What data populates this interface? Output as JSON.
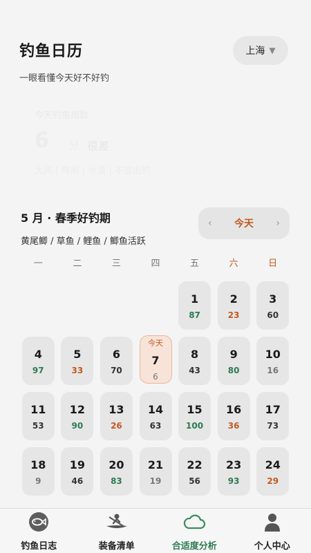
{
  "header": {
    "title": "钓鱼日历",
    "subtitle": "一眼看懂今天好不好钓"
  },
  "city": {
    "label": "上海",
    "caret": "▼"
  },
  "today_card": {
    "label": "今天钓鱼指数",
    "score": "6",
    "unit": "分",
    "level": "很差",
    "detail": "大风 | 降雨 | 水温 | 不宜出钓"
  },
  "month": {
    "title": "5 月 · 春季好钓期",
    "species": "黄尾鲫 / 草鱼 / 鲤鱼 / 鲫鱼活跃"
  },
  "nav": {
    "prev": "‹",
    "today": "今天",
    "next": "›"
  },
  "weekdays": [
    "一",
    "二",
    "三",
    "四",
    "五",
    "六",
    "日"
  ],
  "weekend_indices": [
    5,
    6
  ],
  "today_tag": "今天",
  "days": [
    {
      "day": "1",
      "score": "87",
      "tone": "green"
    },
    {
      "day": "2",
      "score": "23",
      "tone": "orange"
    },
    {
      "day": "3",
      "score": "60",
      "tone": "dark"
    },
    {
      "day": "4",
      "score": "97",
      "tone": "green"
    },
    {
      "day": "5",
      "score": "33",
      "tone": "orange"
    },
    {
      "day": "6",
      "score": "70",
      "tone": "dark"
    },
    {
      "day": "7",
      "score": "6",
      "tone": "gray",
      "today": true
    },
    {
      "day": "8",
      "score": "43",
      "tone": "dark"
    },
    {
      "day": "9",
      "score": "80",
      "tone": "green"
    },
    {
      "day": "10",
      "score": "16",
      "tone": "gray"
    },
    {
      "day": "11",
      "score": "53",
      "tone": "dark"
    },
    {
      "day": "12",
      "score": "90",
      "tone": "green"
    },
    {
      "day": "13",
      "score": "26",
      "tone": "orange"
    },
    {
      "day": "14",
      "score": "63",
      "tone": "dark"
    },
    {
      "day": "15",
      "score": "100",
      "tone": "green"
    },
    {
      "day": "16",
      "score": "36",
      "tone": "orange"
    },
    {
      "day": "17",
      "score": "73",
      "tone": "dark"
    },
    {
      "day": "18",
      "score": "9",
      "tone": "gray"
    },
    {
      "day": "19",
      "score": "46",
      "tone": "dark"
    },
    {
      "day": "20",
      "score": "83",
      "tone": "green"
    },
    {
      "day": "21",
      "score": "19",
      "tone": "gray"
    },
    {
      "day": "22",
      "score": "56",
      "tone": "dark"
    },
    {
      "day": "23",
      "score": "93",
      "tone": "green"
    },
    {
      "day": "24",
      "score": "29",
      "tone": "orange"
    }
  ],
  "first_weekday_index": 4,
  "tabs": [
    {
      "label": "钓鱼日志",
      "icon": "fish-icon",
      "active": false
    },
    {
      "label": "装备清单",
      "icon": "kayak-icon",
      "active": false
    },
    {
      "label": "合适度分析",
      "icon": "cloud-icon",
      "active": true
    },
    {
      "label": "个人中心",
      "icon": "person-icon",
      "active": false
    }
  ],
  "colors": {
    "accent": "#c25a22",
    "good": "#2e7a52",
    "bg": "#f4f4f4",
    "cell": "#e6e6e6"
  }
}
